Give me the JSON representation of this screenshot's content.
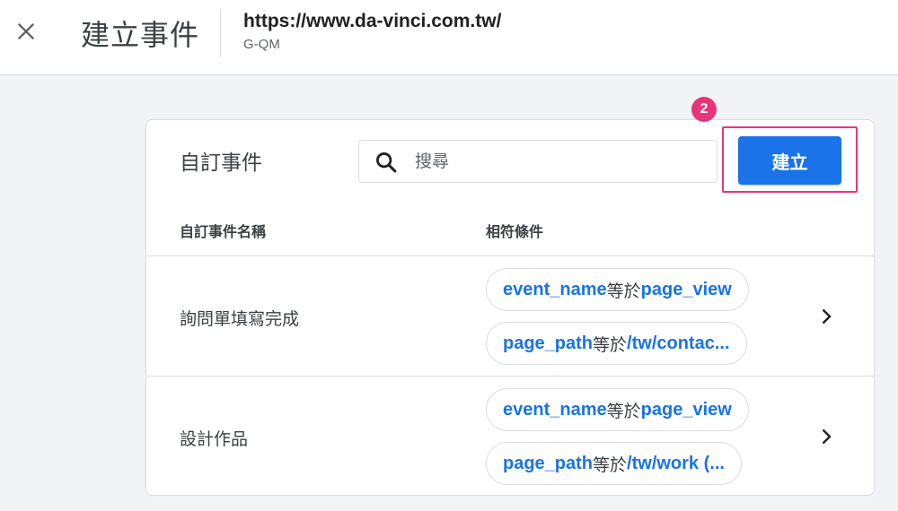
{
  "header": {
    "title": "建立事件",
    "site_url": "https://www.da-vinci.com.tw/",
    "site_id": "G-QM"
  },
  "card": {
    "title": "自訂事件",
    "search_placeholder": "搜尋",
    "create_label": "建立",
    "step_badge": "2",
    "columns": {
      "name": "自訂事件名稱",
      "conditions": "相符條件"
    },
    "rows": [
      {
        "name": "詢問單填寫完成",
        "conditions": [
          {
            "key": "event_name",
            "op": "等於",
            "value": "page_view"
          },
          {
            "key": "page_path",
            "op": "等於",
            "value": "/tw/contac..."
          }
        ]
      },
      {
        "name": "設計作品",
        "conditions": [
          {
            "key": "event_name",
            "op": "等於",
            "value": "page_view"
          },
          {
            "key": "page_path",
            "op": "等於",
            "value": "/tw/work (..."
          }
        ]
      }
    ]
  },
  "colors": {
    "accent": "#1a73e8",
    "highlight": "#e8357a",
    "background": "#f1f3f4"
  },
  "icons": [
    "close-icon",
    "search-icon",
    "chevron-right-icon"
  ]
}
